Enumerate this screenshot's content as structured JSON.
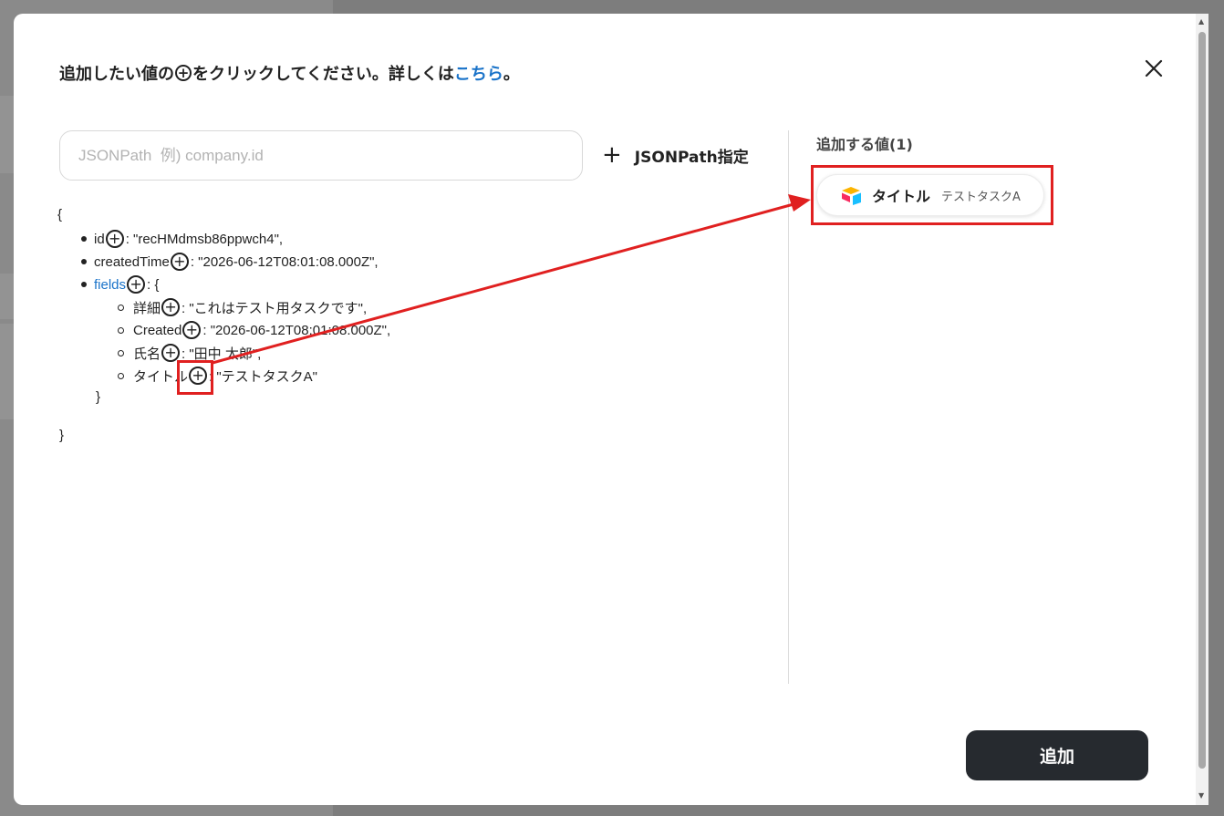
{
  "heading": {
    "before": "追加したい値の",
    "after": "をクリックしてください。詳しくは",
    "link": "こちら",
    "end": "。"
  },
  "icons": {
    "close": "close-icon",
    "add": "plus-circle-icon",
    "app": "airtable-icon"
  },
  "input": {
    "placeholder": "JSONPath  例) company.id",
    "value": ""
  },
  "jsonpath_button": {
    "label": "JSONPath指定"
  },
  "json_tree": {
    "open": "{",
    "close": "}",
    "rows": [
      {
        "key": "id",
        "value": ": \"recHMdmsb86ppwch4\","
      },
      {
        "key": "createdTime",
        "value": ": \"2026-06-12T08:01:08.000Z\","
      },
      {
        "key": "fields",
        "value": ": {"
      }
    ],
    "fields": [
      {
        "key": "詳細",
        "value": ": \"これはテスト用タスクです\","
      },
      {
        "key": "Created",
        "value": ": \"2026-06-12T08:01:08.000Z\","
      },
      {
        "key": "氏名",
        "value": ": \"田中 太郎\","
      },
      {
        "key": "タイトル",
        "value": ": \"テストタスクA\""
      }
    ],
    "fields_close": "}"
  },
  "right": {
    "title": "追加する値(1)",
    "chips": [
      {
        "label": "タイトル",
        "value": "テストタスクA"
      }
    ]
  },
  "add_button": {
    "label": "追加"
  },
  "colors": {
    "link": "#1a73c9",
    "highlight": "#e02020",
    "button": "#262a2f"
  }
}
